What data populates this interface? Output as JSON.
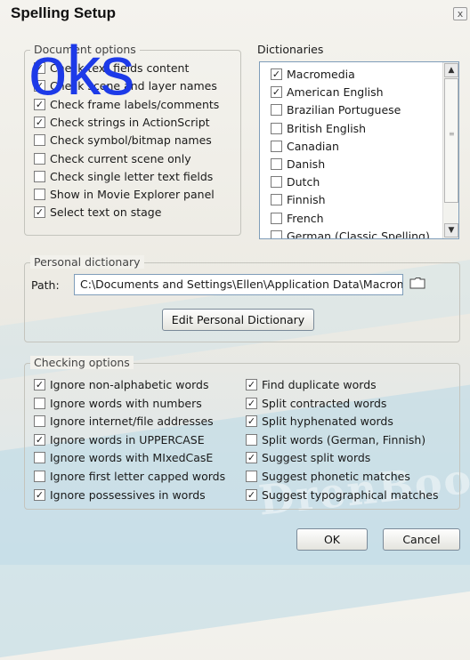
{
  "window": {
    "title": "Spelling Setup",
    "close_glyph": "x"
  },
  "watermark": {
    "text": "oks",
    "brand": "DrenBooks"
  },
  "document_options": {
    "legend": "Document options",
    "items": [
      {
        "label": "Check text fields content",
        "checked": true
      },
      {
        "label": "Check scene and layer names",
        "checked": true
      },
      {
        "label": "Check frame labels/comments",
        "checked": true
      },
      {
        "label": "Check strings in ActionScript",
        "checked": true
      },
      {
        "label": "Check symbol/bitmap names",
        "checked": false
      },
      {
        "label": "Check current scene only",
        "checked": false
      },
      {
        "label": "Check single letter text fields",
        "checked": false
      },
      {
        "label": "Show in Movie Explorer panel",
        "checked": false
      },
      {
        "label": "Select text on stage",
        "checked": true
      }
    ]
  },
  "dictionaries": {
    "label": "Dictionaries",
    "items": [
      {
        "label": "Macromedia",
        "checked": true
      },
      {
        "label": "American English",
        "checked": true
      },
      {
        "label": "Brazilian Portuguese",
        "checked": false
      },
      {
        "label": "British English",
        "checked": false
      },
      {
        "label": "Canadian",
        "checked": false
      },
      {
        "label": "Danish",
        "checked": false
      },
      {
        "label": "Dutch",
        "checked": false
      },
      {
        "label": "Finnish",
        "checked": false
      },
      {
        "label": "French",
        "checked": false
      },
      {
        "label": "German (Classic Spelling)",
        "checked": false
      }
    ]
  },
  "personal_dictionary": {
    "legend": "Personal dictionary",
    "path_label": "Path:",
    "path_value": "C:\\Documents and Settings\\Ellen\\Application Data\\Macrom•",
    "edit_button": "Edit Personal Dictionary"
  },
  "checking_options": {
    "legend": "Checking options",
    "left": [
      {
        "label": "Ignore non-alphabetic words",
        "checked": true
      },
      {
        "label": "Ignore words with numbers",
        "checked": false
      },
      {
        "label": "Ignore internet/file addresses",
        "checked": false
      },
      {
        "label": "Ignore words in UPPERCASE",
        "checked": true
      },
      {
        "label": "Ignore words with MIxedCasE",
        "checked": false
      },
      {
        "label": "Ignore first letter capped words",
        "checked": false
      },
      {
        "label": "Ignore possessives in words",
        "checked": true
      }
    ],
    "right": [
      {
        "label": "Find duplicate words",
        "checked": true
      },
      {
        "label": "Split contracted words",
        "checked": true
      },
      {
        "label": "Split hyphenated words",
        "checked": true
      },
      {
        "label": "Split words (German, Finnish)",
        "checked": false
      },
      {
        "label": "Suggest split words",
        "checked": true
      },
      {
        "label": "Suggest phonetic matches",
        "checked": false
      },
      {
        "label": "Suggest typographical matches",
        "checked": true
      }
    ]
  },
  "buttons": {
    "ok": "OK",
    "cancel": "Cancel"
  },
  "check_glyph": "✓"
}
